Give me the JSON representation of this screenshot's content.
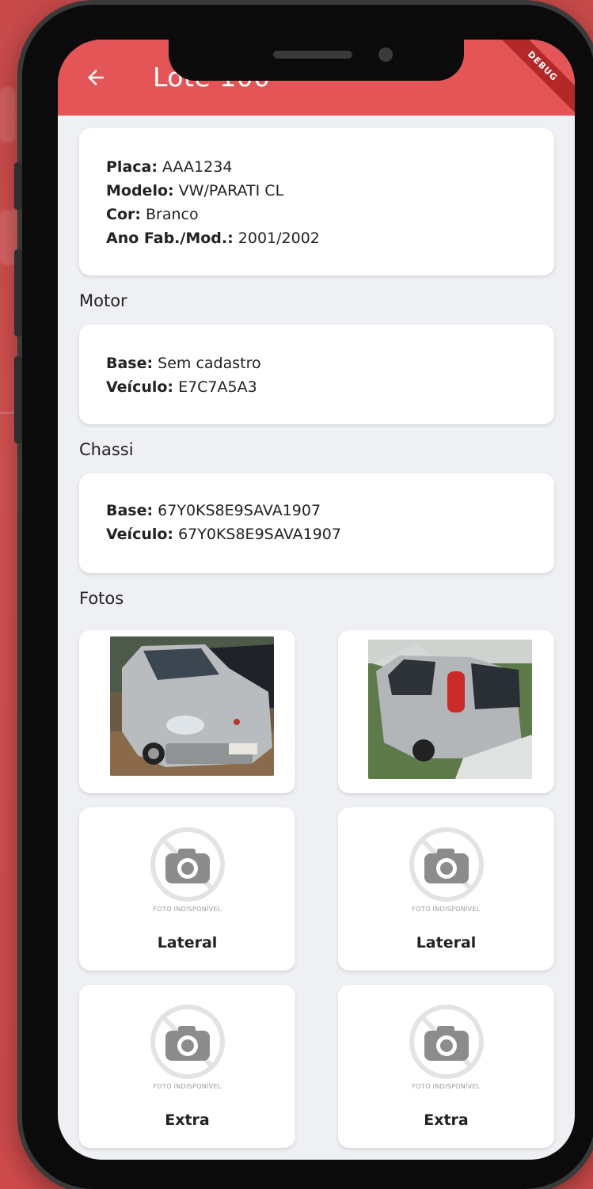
{
  "appbar": {
    "title": "Lote 100",
    "debug_label": "DEBUG"
  },
  "vehicle_card": {
    "lines": [
      {
        "label": "Placa:",
        "value": "AAA1234"
      },
      {
        "label": "Modelo:",
        "value": "VW/PARATI CL"
      },
      {
        "label": "Cor:",
        "value": "Branco"
      },
      {
        "label": "Ano Fab./Mod.:",
        "value": "2001/2002"
      }
    ]
  },
  "motor": {
    "title": "Motor",
    "lines": [
      {
        "label": "Base:",
        "value": "Sem cadastro"
      },
      {
        "label": "Veículo:",
        "value": "E7C7A5A3"
      }
    ]
  },
  "chassi": {
    "title": "Chassi",
    "lines": [
      {
        "label": "Base:",
        "value": "67Y0KS8E9SAVA1907"
      },
      {
        "label": "Veículo:",
        "value": "67Y0KS8E9SAVA1907"
      }
    ]
  },
  "fotos": {
    "title": "Fotos",
    "photos": [
      {
        "type": "image",
        "icon": "car-front-photo"
      },
      {
        "type": "image",
        "icon": "car-rear-photo"
      },
      {
        "type": "placeholder",
        "caption": "FOTO INDISPONÍVEL",
        "label": "Lateral"
      },
      {
        "type": "placeholder",
        "caption": "FOTO INDISPONÍVEL",
        "label": "Lateral"
      },
      {
        "type": "placeholder",
        "caption": "FOTO INDISPONÍVEL",
        "label": "Extra"
      },
      {
        "type": "placeholder",
        "caption": "FOTO INDISPONÍVEL",
        "label": "Extra"
      }
    ]
  },
  "colors": {
    "appbar": "#e35556",
    "background": "#eef0f4",
    "card": "#ffffff",
    "debug_ribbon": "#b32828"
  }
}
